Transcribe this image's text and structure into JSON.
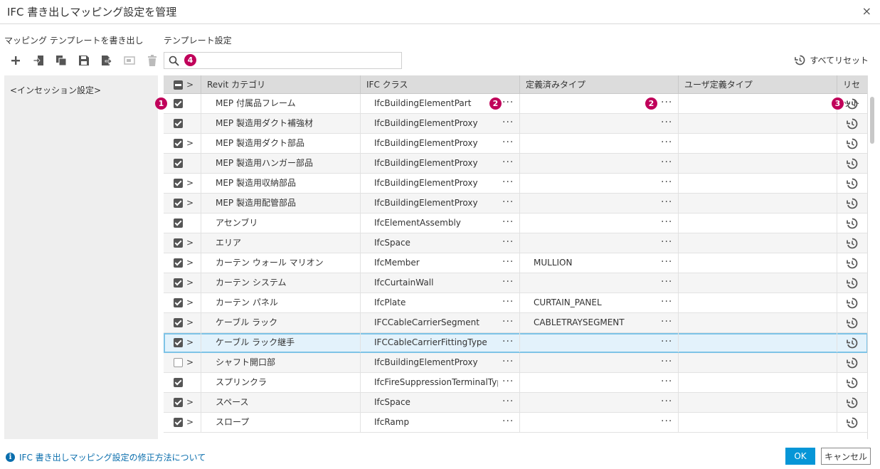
{
  "window": {
    "title": "IFC 書き出しマッピング設定を管理",
    "close_glyph": "×"
  },
  "left": {
    "heading": "マッピング テンプレートを書き出し",
    "toolbar": [
      "plus-icon",
      "import-icon",
      "copy-icon",
      "save-icon",
      "export-icon",
      "rename-icon",
      "delete-icon"
    ],
    "templates": [
      "<インセッション設定>"
    ]
  },
  "right": {
    "heading": "テンプレート設定",
    "search": {
      "value": "",
      "placeholder": ""
    },
    "reset_all_label": "すべてリセット"
  },
  "badges": {
    "b1": "1",
    "b2a": "2",
    "b2b": "2",
    "b3": "3",
    "b4": "4"
  },
  "table": {
    "headers": {
      "expand": ">",
      "category": "Revit カテゴリ",
      "ifc_class": "IFC クラス",
      "predefined": "定義済みタイプ",
      "user_defined": "ユーザ定義タイプ",
      "reset": "リセット"
    },
    "more_glyph": "···",
    "rows": [
      {
        "checked": true,
        "expandable": false,
        "category": "MEP 付属品フレーム",
        "ifc_class": "IfcBuildingElementPart",
        "predefined": "",
        "user_defined": ""
      },
      {
        "checked": true,
        "expandable": false,
        "category": "MEP 製造用ダクト補強材",
        "ifc_class": "IfcBuildingElementProxy",
        "predefined": "",
        "user_defined": ""
      },
      {
        "checked": true,
        "expandable": true,
        "category": "MEP 製造用ダクト部品",
        "ifc_class": "IfcBuildingElementProxy",
        "predefined": "",
        "user_defined": ""
      },
      {
        "checked": true,
        "expandable": false,
        "category": "MEP 製造用ハンガー部品",
        "ifc_class": "IfcBuildingElementProxy",
        "predefined": "",
        "user_defined": ""
      },
      {
        "checked": true,
        "expandable": true,
        "category": "MEP 製造用収納部品",
        "ifc_class": "IfcBuildingElementProxy",
        "predefined": "",
        "user_defined": ""
      },
      {
        "checked": true,
        "expandable": true,
        "category": "MEP 製造用配管部品",
        "ifc_class": "IfcBuildingElementProxy",
        "predefined": "",
        "user_defined": ""
      },
      {
        "checked": true,
        "expandable": false,
        "category": "アセンブリ",
        "ifc_class": "IfcElementAssembly",
        "predefined": "",
        "user_defined": ""
      },
      {
        "checked": true,
        "expandable": true,
        "category": "エリア",
        "ifc_class": "IfcSpace",
        "predefined": "",
        "user_defined": ""
      },
      {
        "checked": true,
        "expandable": true,
        "category": "カーテン ウォール マリオン",
        "ifc_class": "IfcMember",
        "predefined": "MULLION",
        "user_defined": ""
      },
      {
        "checked": true,
        "expandable": true,
        "category": "カーテン システム",
        "ifc_class": "IfcCurtainWall",
        "predefined": "",
        "user_defined": ""
      },
      {
        "checked": true,
        "expandable": true,
        "category": "カーテン パネル",
        "ifc_class": "IfcPlate",
        "predefined": "CURTAIN_PANEL",
        "user_defined": ""
      },
      {
        "checked": true,
        "expandable": true,
        "category": "ケーブル ラック",
        "ifc_class": "IFCCableCarrierSegment",
        "predefined": "CABLETRAYSEGMENT",
        "user_defined": ""
      },
      {
        "checked": true,
        "expandable": true,
        "category": "ケーブル ラック継手",
        "ifc_class": "IFCCableCarrierFittingType",
        "predefined": "",
        "user_defined": "",
        "selected": true
      },
      {
        "checked": false,
        "expandable": true,
        "category": "シャフト開口部",
        "ifc_class": "IfcBuildingElementProxy",
        "predefined": "",
        "user_defined": ""
      },
      {
        "checked": true,
        "expandable": false,
        "category": "スプリンクラ",
        "ifc_class": "IfcFireSuppressionTerminalType",
        "predefined": "",
        "user_defined": ""
      },
      {
        "checked": true,
        "expandable": true,
        "category": "スペース",
        "ifc_class": "IfcSpace",
        "predefined": "",
        "user_defined": ""
      },
      {
        "checked": true,
        "expandable": true,
        "category": "スロープ",
        "ifc_class": "IfcRamp",
        "predefined": "",
        "user_defined": ""
      }
    ]
  },
  "footer": {
    "info_glyph": "i",
    "help_link": "IFC 書き出しマッピング設定の修正方法について",
    "ok_label": "OK",
    "cancel_label": "キャンセル"
  }
}
